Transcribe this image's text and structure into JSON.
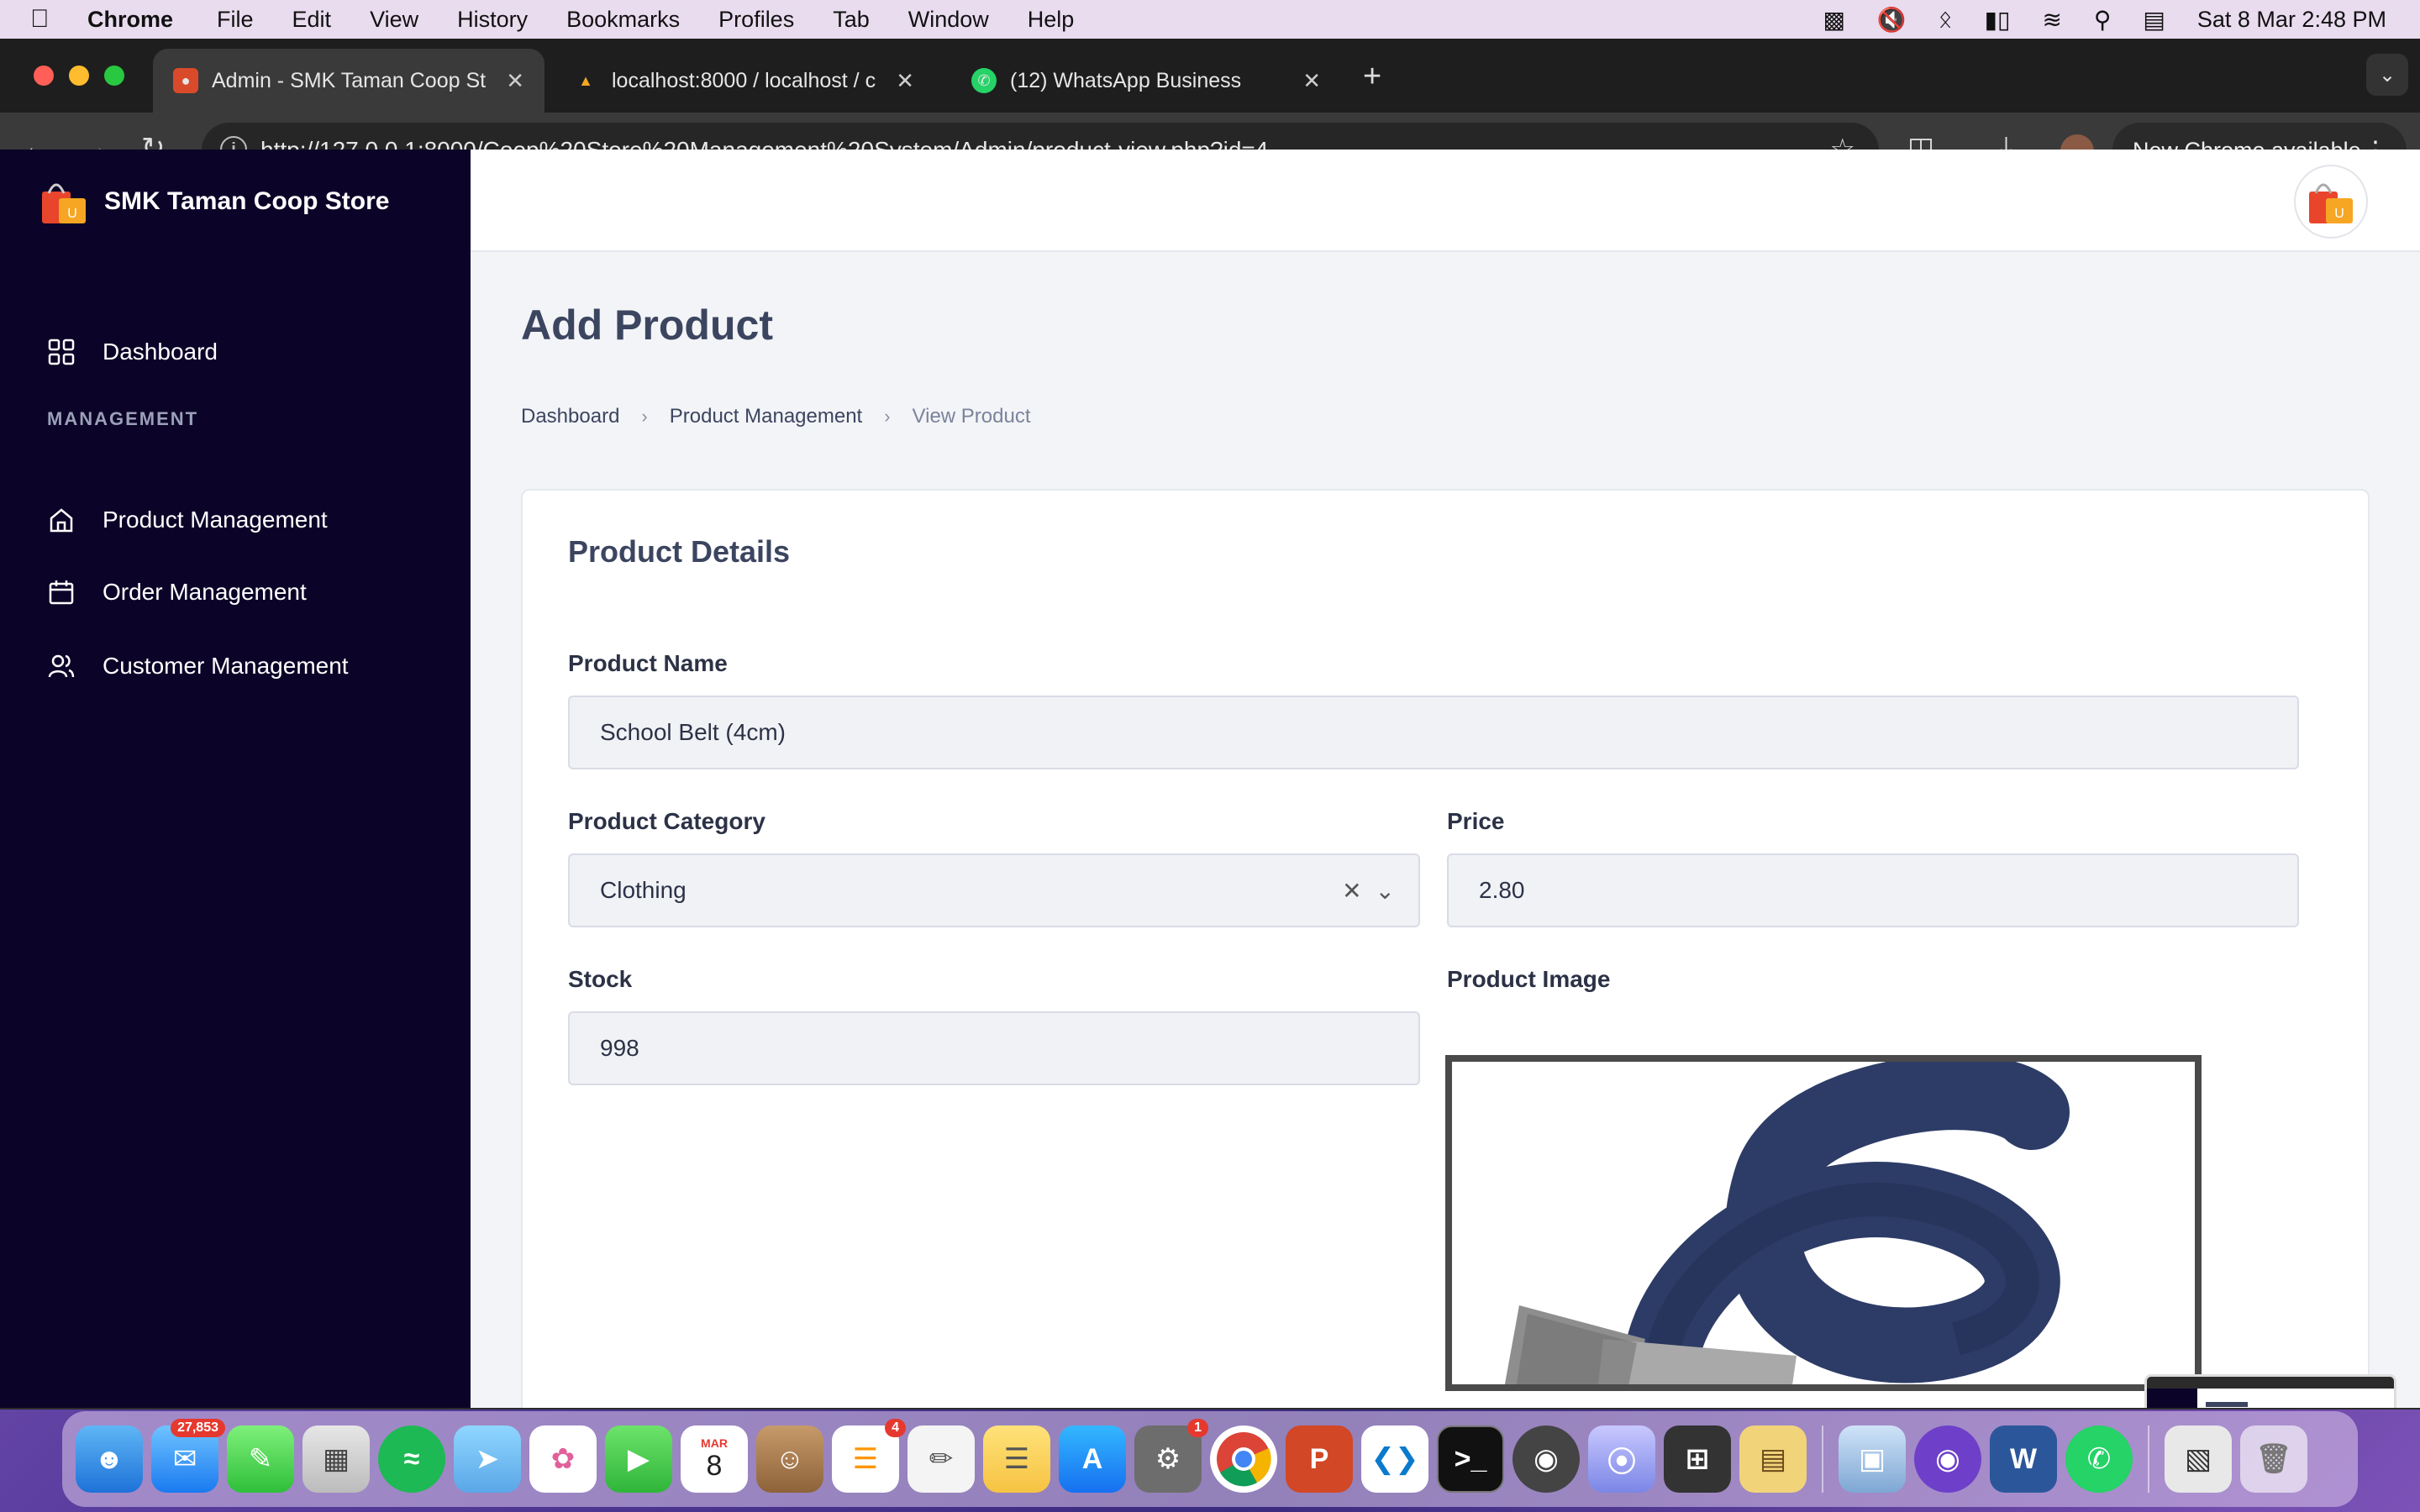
{
  "menubar": {
    "app": "Chrome",
    "items": [
      "File",
      "Edit",
      "View",
      "History",
      "Bookmarks",
      "Profiles",
      "Tab",
      "Window",
      "Help"
    ],
    "datetime": "Sat 8 Mar  2:48 PM"
  },
  "tabs": [
    {
      "title": "Admin - SMK Taman Coop St",
      "active": true
    },
    {
      "title": "localhost:8000 / localhost / c",
      "active": false
    },
    {
      "title": "(12) WhatsApp Business",
      "active": false
    }
  ],
  "toolbar": {
    "url": "http://127.0.0.1:8000/Coop%20Store%20Management%20System/Admin/product-view.php?id=4",
    "update_label": "New Chrome available"
  },
  "sidebar": {
    "brand": "SMK Taman Coop Store",
    "dashboard": "Dashboard",
    "section": "MANAGEMENT",
    "items": [
      {
        "label": "Product Management",
        "icon": "home-icon"
      },
      {
        "label": "Order Management",
        "icon": "calendar-icon"
      },
      {
        "label": "Customer Management",
        "icon": "users-icon"
      }
    ]
  },
  "page": {
    "title": "Add Product",
    "breadcrumb": [
      "Dashboard",
      "Product Management",
      "View Product"
    ]
  },
  "form": {
    "card_title": "Product Details",
    "name_label": "Product Name",
    "name_value": "School Belt (4cm)",
    "category_label": "Product Category",
    "category_value": "Clothing",
    "price_label": "Price",
    "price_value": "2.80",
    "stock_label": "Stock",
    "stock_value": "998",
    "image_label": "Product Image"
  },
  "dock": {
    "mail_badge": "27,853",
    "calendar_month": "MAR",
    "calendar_day": "8",
    "reminders_badge": "4",
    "settings_badge": "1"
  }
}
